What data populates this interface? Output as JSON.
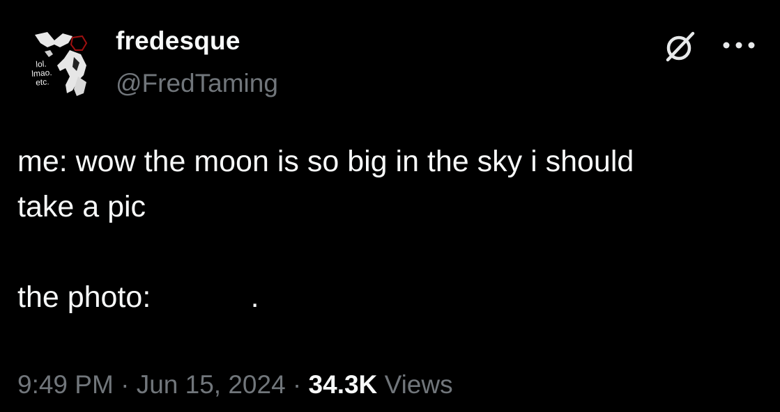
{
  "author": {
    "display_name": "fredesque",
    "handle": "@FredTaming",
    "avatar_caption": [
      "lol.",
      "lmao.",
      "etc."
    ]
  },
  "header_actions": {
    "grok_icon": "grok-icon",
    "more_icon": "more-dots-icon"
  },
  "tweet": {
    "lines": [
      "me: wow the moon is so big in the sky i should",
      "take a pic",
      "",
      "the photo:            ."
    ]
  },
  "meta": {
    "time": "9:49 PM",
    "separator": " · ",
    "date": "Jun 15, 2024",
    "views_count": "34.3K",
    "views_label": "Views"
  },
  "colors": {
    "background": "#000000",
    "primary_text": "#f7f9f9",
    "secondary_text": "#71767b"
  }
}
